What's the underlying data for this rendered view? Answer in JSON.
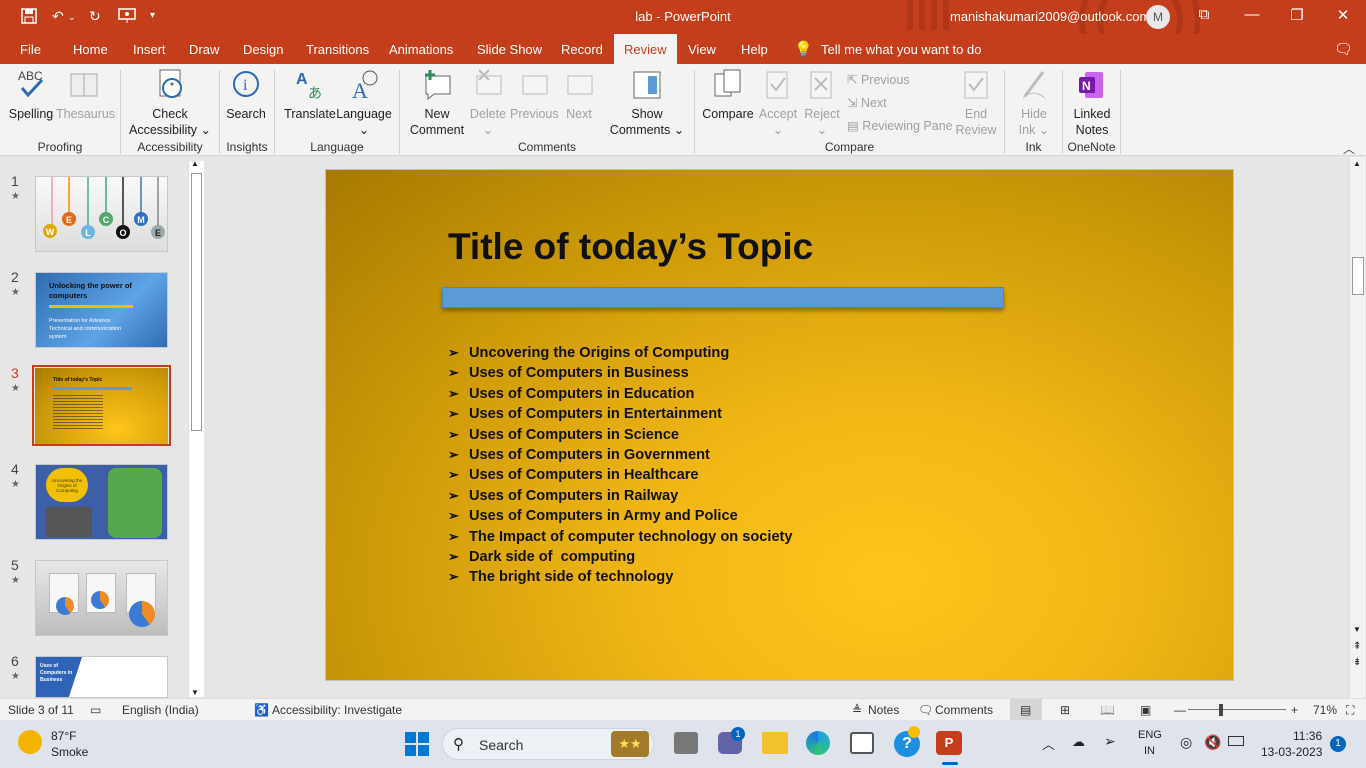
{
  "window": {
    "app_title": "lab  -  PowerPoint",
    "user_email": "manishakumari2009@outlook.com",
    "avatar_letter": "M"
  },
  "tabs": [
    "File",
    "Home",
    "Insert",
    "Draw",
    "Design",
    "Transitions",
    "Animations",
    "Slide Show",
    "Record",
    "Review",
    "View",
    "Help"
  ],
  "tell_me": "Tell me what you want to do",
  "ribbon": {
    "spelling": "Spelling",
    "thesaurus": "Thesaurus",
    "check": "Check",
    "accessibility": "Accessibility",
    "search": "Search",
    "translate": "Translate",
    "language": "Language",
    "new": "New",
    "comment": "Comment",
    "delete": "Delete",
    "previous": "Previous",
    "next": "Next",
    "show": "Show",
    "comments": "Comments",
    "compare": "Compare",
    "accept": "Accept",
    "reject": "Reject",
    "prev_small": "Previous",
    "next_small": "Next",
    "reviewing_pane": "Reviewing Pane",
    "end": "End",
    "review": "Review",
    "hide": "Hide",
    "ink": "Ink",
    "linked": "Linked",
    "notes": "Notes",
    "groups": {
      "proofing": "Proofing",
      "accessibility": "Accessibility",
      "insights": "Insights",
      "language": "Language",
      "comments": "Comments",
      "compare": "Compare",
      "ink": "Ink",
      "onenote": "OneNote"
    }
  },
  "thumbnails": {
    "numbers": [
      "1",
      "2",
      "3",
      "4",
      "5",
      "6"
    ],
    "welcome_letters": [
      "W",
      "E",
      "L",
      "C",
      "O",
      "M",
      "E"
    ],
    "t2_title": "Unlocking the power of computers",
    "t2_sub": "Presentation for Advance Technical and communication system",
    "t3_title": "Title of today's Topic",
    "t4_text": "Uncovering the Origins of Computing",
    "t6_text": "Uses of Computers in Business"
  },
  "slide": {
    "title": "Title of today’s Topic",
    "bullets": [
      "Uncovering the Origins of Computing",
      "Uses of Computers in Business",
      "Uses of Computers in Education",
      "Uses of Computers in Entertainment",
      "Uses of Computers in Science",
      "Uses of Computers in Government",
      "Uses of Computers in Healthcare",
      "Uses of Computers in Railway",
      "Uses of Computers in Army and Police",
      "The Impact of computer technology on society",
      "Dark side of  computing",
      "The bright side of technology"
    ]
  },
  "status": {
    "slide_info": "Slide 3 of 11",
    "language": "English (India)",
    "accessibility": "Accessibility: Investigate",
    "notes": "Notes",
    "comments": "Comments",
    "zoom": "71%"
  },
  "taskbar": {
    "temp": "87°F",
    "weather": "Smoke",
    "search": "Search",
    "lang1": "ENG",
    "lang2": "IN",
    "time": "11:36",
    "date": "13-03-2023",
    "notif": "1",
    "teams_badge": "1"
  },
  "colors": {
    "accent": "#c43e1c",
    "slide_bar": "#5b9bd5"
  }
}
